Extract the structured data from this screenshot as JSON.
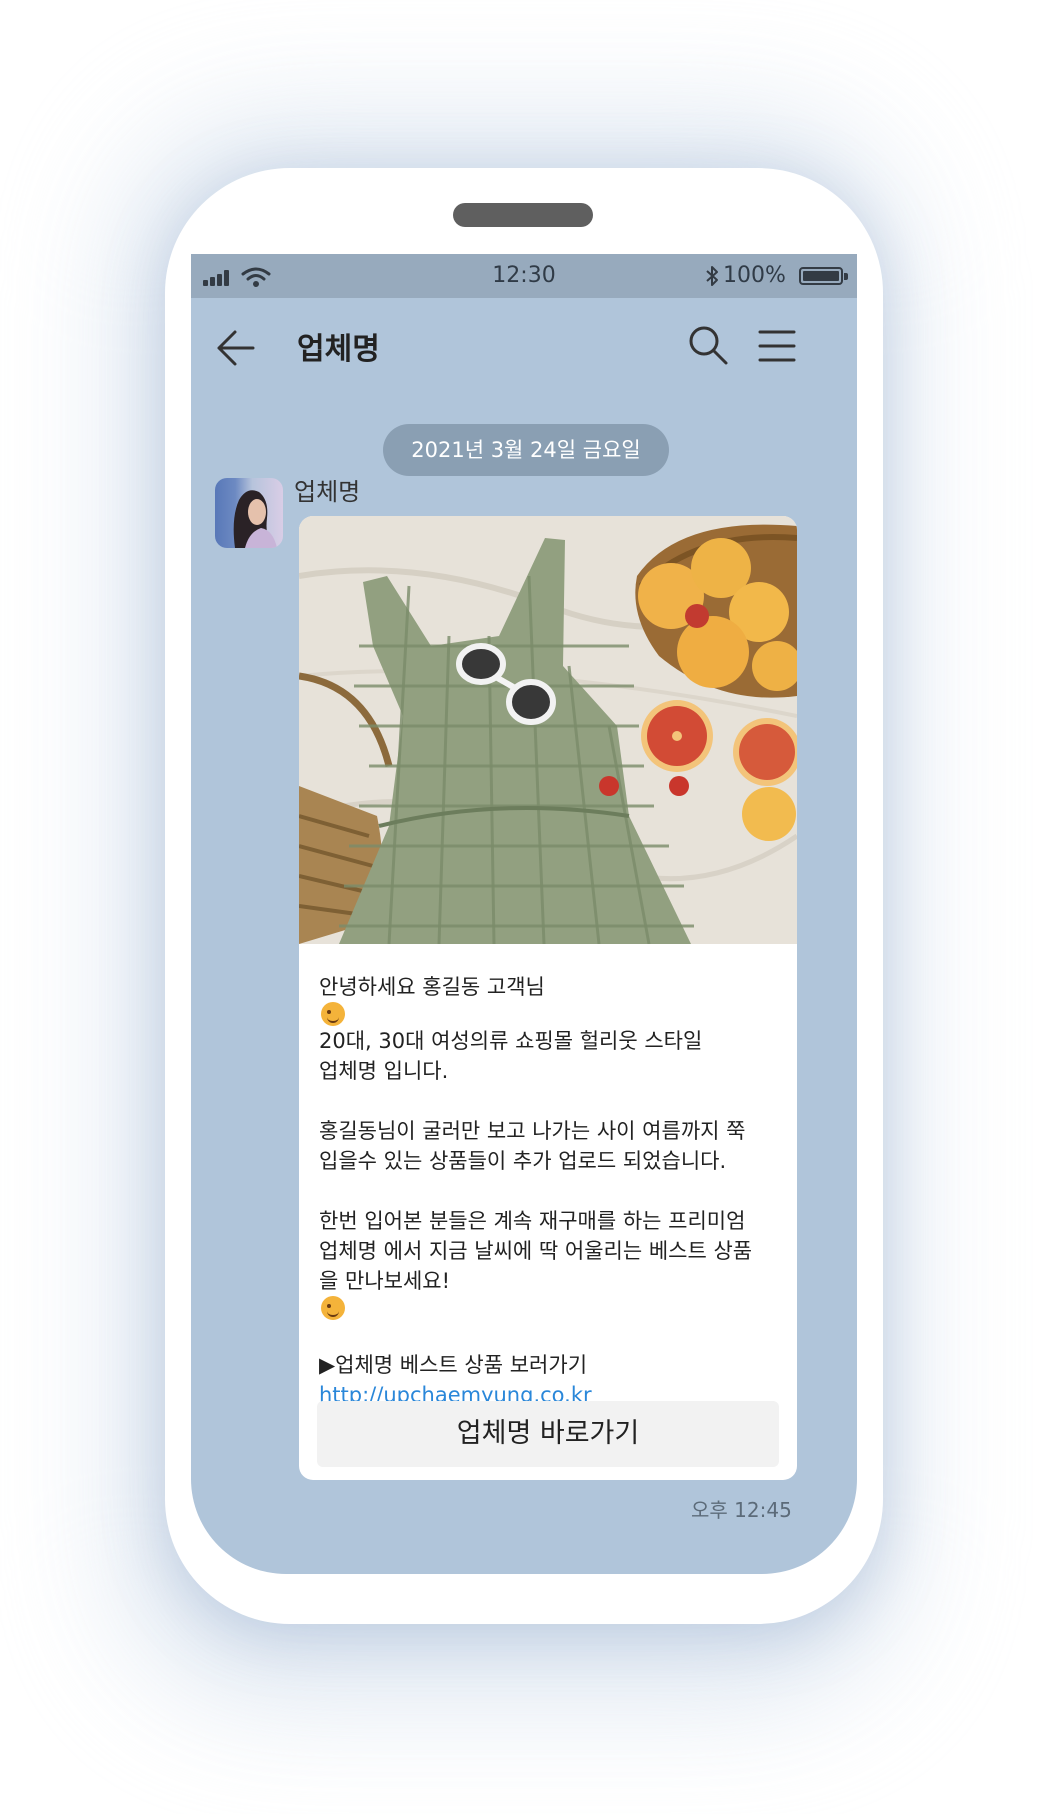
{
  "status_bar": {
    "time": "12:30",
    "battery": "100%"
  },
  "app_bar": {
    "title": "업체명"
  },
  "chat": {
    "date_separator": "2021년 3월 24일 금요일",
    "sender_name": "업체명",
    "message": {
      "para1": [
        "안녕하세요 홍길동 고객님",
        "20대, 30대 여성의류 쇼핑몰 헐리웃 스타일",
        "업체명 입니다."
      ],
      "para2": [
        "홍길동님이 굴러만 보고 나가는 사이 여름까지 쭉",
        "입을수 있는 상품들이 추가 업로드 되었습니다."
      ],
      "para3": [
        "한번 입어본 분들은 계속 재구매를 하는 프리미엄",
        "업체명 에서 지금 날씨에 딱 어울리는 베스트 상품",
        "을 만나보세요!"
      ],
      "link_label": "▶업체명 베스트 상품 보러가기",
      "link_url": "http://upchaemyung.co.kr"
    },
    "button_label": "업체명 바로가기",
    "timestamp": "오후 12:45"
  },
  "icons": [
    "signal-icon",
    "wifi-icon",
    "bluetooth-icon",
    "battery-icon",
    "back-arrow-icon",
    "search-icon",
    "menu-icon",
    "wink-emoji-icon"
  ],
  "colors": {
    "chat_background": "#b0c5da",
    "status_bar": "#97aabd",
    "date_pill": "#8a9fb3",
    "link": "#2a87d9"
  }
}
